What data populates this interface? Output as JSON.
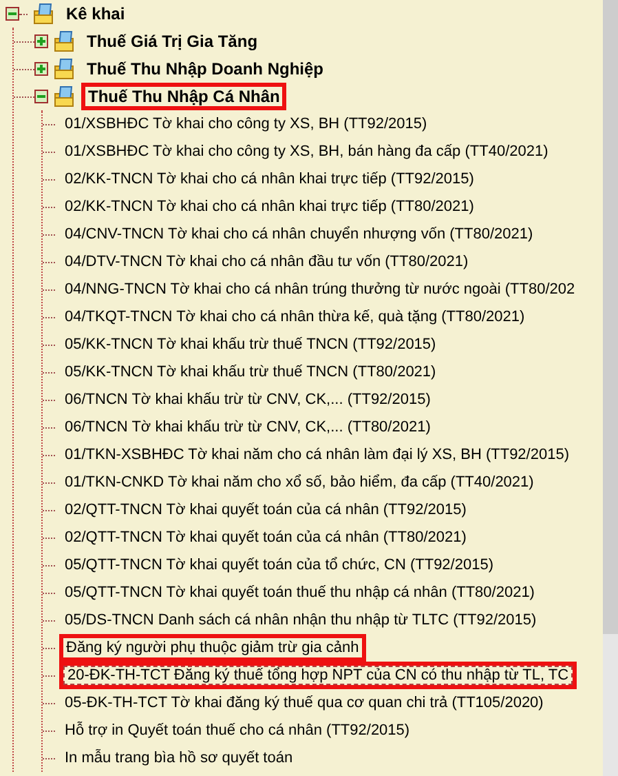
{
  "tree": [
    {
      "label": "Kê khai",
      "kind": "folder",
      "expanded": true,
      "highlighted": false,
      "selected": false,
      "children": [
        {
          "label": "Thuế Giá Trị Gia Tăng",
          "kind": "folder",
          "expanded": false,
          "highlighted": false,
          "selected": false
        },
        {
          "label": "Thuế Thu Nhập Doanh Nghiệp",
          "kind": "folder",
          "expanded": false,
          "highlighted": false,
          "selected": false
        },
        {
          "label": "Thuế Thu Nhập Cá Nhân",
          "kind": "folder",
          "expanded": true,
          "highlighted": true,
          "selected": false,
          "children": [
            {
              "label": "01/XSBHĐC Tờ khai cho công ty XS, BH (TT92/2015)",
              "kind": "form",
              "highlighted": false,
              "selected": false
            },
            {
              "label": "01/XSBHĐC Tờ khai cho công ty XS, BH, bán hàng đa cấp (TT40/2021)",
              "kind": "form",
              "highlighted": false,
              "selected": false
            },
            {
              "label": "02/KK-TNCN Tờ khai cho cá nhân khai trực tiếp (TT92/2015)",
              "kind": "form",
              "highlighted": false,
              "selected": false
            },
            {
              "label": "02/KK-TNCN Tờ khai cho cá nhân khai trực tiếp (TT80/2021)",
              "kind": "form",
              "highlighted": false,
              "selected": false
            },
            {
              "label": "04/CNV-TNCN Tờ khai cho cá nhân chuyển nhượng vốn (TT80/2021)",
              "kind": "form",
              "highlighted": false,
              "selected": false
            },
            {
              "label": "04/DTV-TNCN Tờ khai cho cá nhân đầu tư vốn (TT80/2021)",
              "kind": "form",
              "highlighted": false,
              "selected": false
            },
            {
              "label": "04/NNG-TNCN Tờ khai cho cá nhân trúng thưởng từ nước ngoài (TT80/202",
              "kind": "form",
              "highlighted": false,
              "selected": false
            },
            {
              "label": "04/TKQT-TNCN Tờ khai cho cá nhân thừa kế, quà tặng (TT80/2021)",
              "kind": "form",
              "highlighted": false,
              "selected": false
            },
            {
              "label": "05/KK-TNCN Tờ khai khấu trừ thuế TNCN (TT92/2015)",
              "kind": "form",
              "highlighted": false,
              "selected": false
            },
            {
              "label": "05/KK-TNCN Tờ khai khấu trừ thuế TNCN (TT80/2021)",
              "kind": "form",
              "highlighted": false,
              "selected": false
            },
            {
              "label": "06/TNCN Tờ khai khấu trừ từ CNV, CK,... (TT92/2015)",
              "kind": "form",
              "highlighted": false,
              "selected": false
            },
            {
              "label": "06/TNCN Tờ khai khấu trừ từ CNV, CK,... (TT80/2021)",
              "kind": "form",
              "highlighted": false,
              "selected": false
            },
            {
              "label": "01/TKN-XSBHĐC Tờ khai năm cho cá nhân làm đại lý XS, BH (TT92/2015)",
              "kind": "form",
              "highlighted": false,
              "selected": false
            },
            {
              "label": "01/TKN-CNKD Tờ khai năm cho xổ số, bảo hiểm, đa cấp (TT40/2021)",
              "kind": "form",
              "highlighted": false,
              "selected": false
            },
            {
              "label": "02/QTT-TNCN Tờ khai quyết toán của cá nhân (TT92/2015)",
              "kind": "form",
              "highlighted": false,
              "selected": false
            },
            {
              "label": "02/QTT-TNCN Tờ khai quyết toán của cá nhân (TT80/2021)",
              "kind": "form",
              "highlighted": false,
              "selected": false
            },
            {
              "label": "05/QTT-TNCN Tờ khai quyết toán của tổ chức, CN (TT92/2015)",
              "kind": "form",
              "highlighted": false,
              "selected": false
            },
            {
              "label": "05/QTT-TNCN Tờ khai quyết toán thuế thu nhập cá nhân (TT80/2021)",
              "kind": "form",
              "highlighted": false,
              "selected": false
            },
            {
              "label": "05/DS-TNCN Danh sách cá nhân nhận thu nhập từ TLTC (TT92/2015)",
              "kind": "form",
              "highlighted": false,
              "selected": false
            },
            {
              "label": "Đăng ký người phụ thuộc giảm trừ gia cảnh",
              "kind": "form",
              "highlighted": true,
              "selected": false
            },
            {
              "label": "20-ĐK-TH-TCT Đăng ký thuế tổng hợp NPT của CN có thu nhập từ TL, TC",
              "kind": "form",
              "highlighted": true,
              "selected": true
            },
            {
              "label": "05-ĐK-TH-TCT Tờ khai đăng ký thuế qua cơ quan chi trả (TT105/2020)",
              "kind": "form",
              "highlighted": false,
              "selected": false
            },
            {
              "label": "Hỗ trợ in Quyết toán thuế cho cá nhân (TT92/2015)",
              "kind": "form",
              "highlighted": false,
              "selected": false
            },
            {
              "label": "In mẫu trang bìa hồ sơ quyết toán",
              "kind": "form",
              "highlighted": false,
              "selected": false
            }
          ]
        }
      ]
    }
  ]
}
